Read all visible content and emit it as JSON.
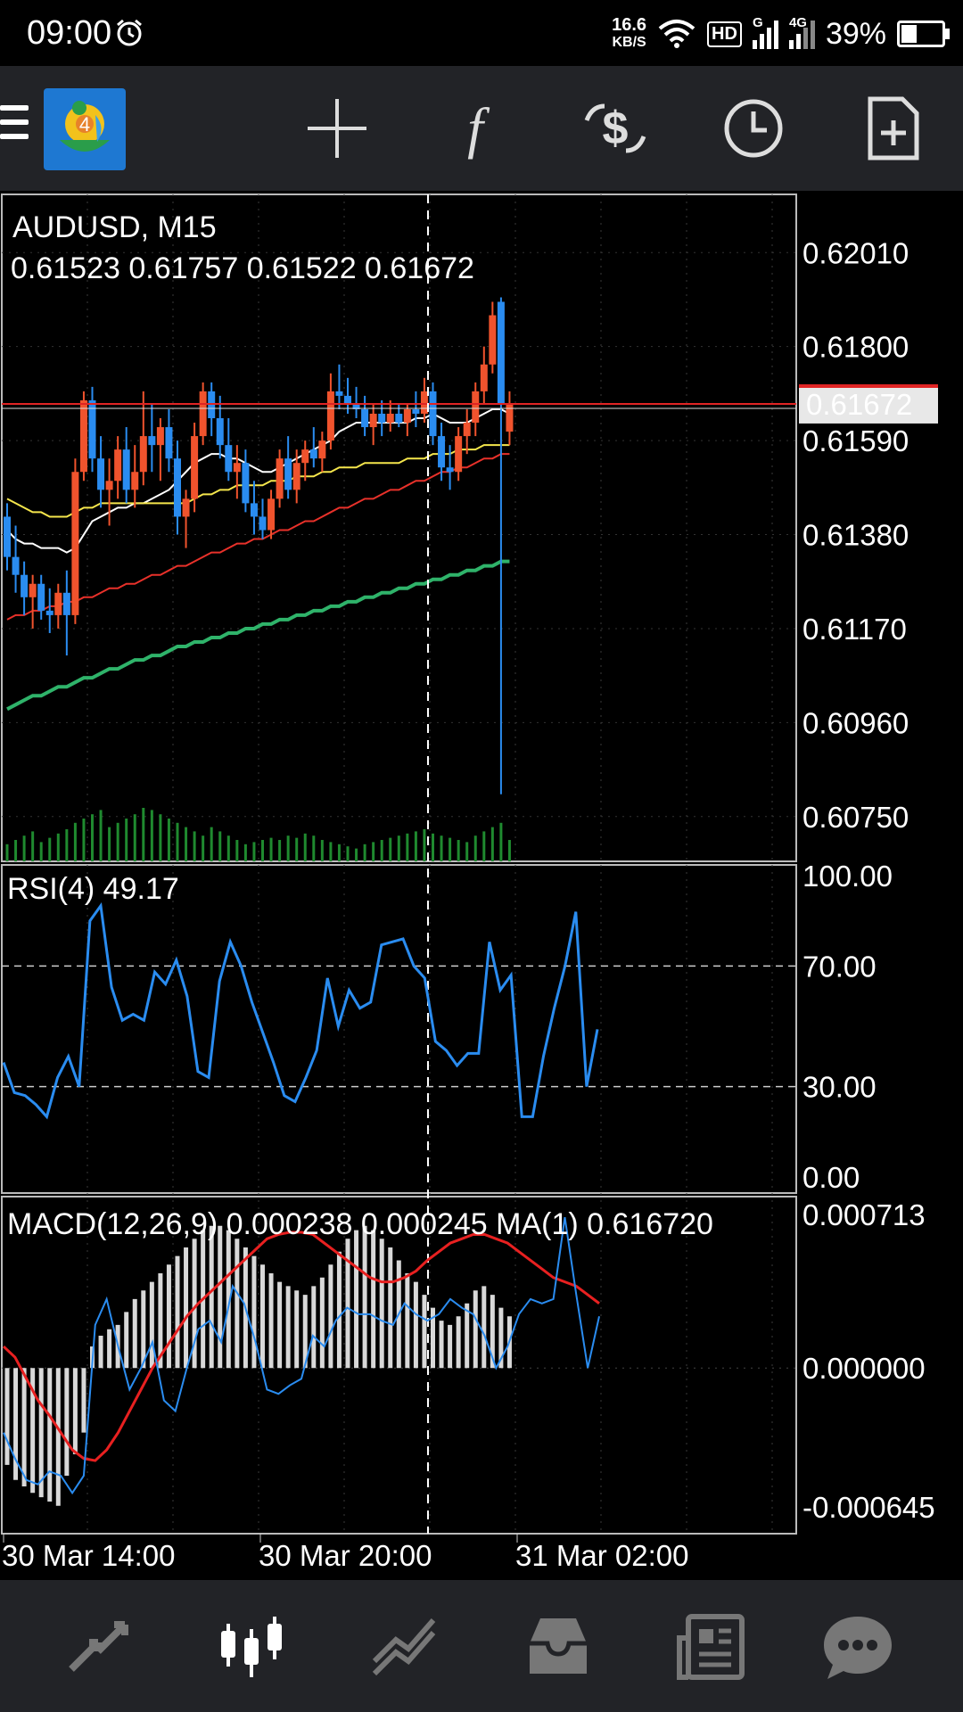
{
  "status_bar": {
    "time": "09:00",
    "speed_value": "16.6",
    "speed_unit": "KB/S",
    "hd": "HD",
    "network_1": "G",
    "network_2": "4G",
    "battery": "39%",
    "battery_level": 0.39
  },
  "toolbar": {
    "logo_badge": "4",
    "icons": [
      "menu-icon",
      "mt4-logo-icon",
      "crosshair-icon",
      "indicators-icon",
      "trade-icon",
      "timeframe-icon",
      "new-order-icon"
    ]
  },
  "chart_data": [
    {
      "type": "candlestick",
      "symbol_label": "AUDUSD, M15",
      "ohlc_label": "0.61523 0.61757 0.61522 0.61672",
      "current_price": "0.61672",
      "ylim": [
        0.6065,
        0.6214
      ],
      "y_ticks": [
        "0.62010",
        "0.61800",
        "0.61590",
        "0.61380",
        "0.61170",
        "0.60960",
        "0.60750"
      ],
      "candles": [
        [
          0.6142,
          0.6145,
          0.613,
          0.6133
        ],
        [
          0.6133,
          0.614,
          0.6125,
          0.6129
        ],
        [
          0.6129,
          0.6132,
          0.612,
          0.6124
        ],
        [
          0.6124,
          0.6129,
          0.6117,
          0.6127
        ],
        [
          0.6127,
          0.6129,
          0.6119,
          0.6121
        ],
        [
          0.6121,
          0.6126,
          0.6116,
          0.612
        ],
        [
          0.612,
          0.6127,
          0.6117,
          0.6125
        ],
        [
          0.6125,
          0.613,
          0.6111,
          0.612
        ],
        [
          0.612,
          0.6155,
          0.6118,
          0.6152
        ],
        [
          0.6152,
          0.617,
          0.615,
          0.6168
        ],
        [
          0.6168,
          0.6171,
          0.6152,
          0.6155
        ],
        [
          0.6155,
          0.616,
          0.6144,
          0.6148
        ],
        [
          0.6148,
          0.6155,
          0.614,
          0.615
        ],
        [
          0.615,
          0.616,
          0.6146,
          0.6157
        ],
        [
          0.6157,
          0.6162,
          0.6145,
          0.6148
        ],
        [
          0.6148,
          0.6158,
          0.6144,
          0.6152
        ],
        [
          0.6152,
          0.617,
          0.6149,
          0.616
        ],
        [
          0.616,
          0.6167,
          0.6152,
          0.6158
        ],
        [
          0.6158,
          0.6164,
          0.615,
          0.6162
        ],
        [
          0.6162,
          0.6166,
          0.6152,
          0.6155
        ],
        [
          0.6155,
          0.6159,
          0.6138,
          0.6142
        ],
        [
          0.6142,
          0.6148,
          0.6135,
          0.6146
        ],
        [
          0.6146,
          0.6163,
          0.6143,
          0.616
        ],
        [
          0.616,
          0.6172,
          0.6158,
          0.617
        ],
        [
          0.617,
          0.6172,
          0.616,
          0.6164
        ],
        [
          0.6164,
          0.6169,
          0.6155,
          0.6158
        ],
        [
          0.6158,
          0.6164,
          0.615,
          0.6152
        ],
        [
          0.6152,
          0.6158,
          0.6146,
          0.6154
        ],
        [
          0.6154,
          0.6157,
          0.6143,
          0.6145
        ],
        [
          0.6145,
          0.615,
          0.6138,
          0.6142
        ],
        [
          0.6142,
          0.6146,
          0.6137,
          0.6139
        ],
        [
          0.6139,
          0.6148,
          0.6137,
          0.6146
        ],
        [
          0.6146,
          0.6157,
          0.6144,
          0.6155
        ],
        [
          0.6155,
          0.616,
          0.6146,
          0.6148
        ],
        [
          0.6148,
          0.6157,
          0.6145,
          0.6154
        ],
        [
          0.6154,
          0.6159,
          0.615,
          0.6157
        ],
        [
          0.6157,
          0.6162,
          0.6153,
          0.6155
        ],
        [
          0.6155,
          0.6161,
          0.6152,
          0.6159
        ],
        [
          0.6159,
          0.6174,
          0.6157,
          0.617
        ],
        [
          0.617,
          0.6176,
          0.6166,
          0.6169
        ],
        [
          0.6169,
          0.6173,
          0.6165,
          0.6167
        ],
        [
          0.6167,
          0.6171,
          0.6164,
          0.6166
        ],
        [
          0.6166,
          0.6169,
          0.616,
          0.6162
        ],
        [
          0.6162,
          0.6167,
          0.6158,
          0.6165
        ],
        [
          0.6165,
          0.6168,
          0.616,
          0.6163
        ],
        [
          0.6163,
          0.6168,
          0.6161,
          0.6165
        ],
        [
          0.6165,
          0.6167,
          0.6162,
          0.6163
        ],
        [
          0.6163,
          0.6167,
          0.616,
          0.6166
        ],
        [
          0.6166,
          0.617,
          0.6162,
          0.6165
        ],
        [
          0.6165,
          0.6173,
          0.6163,
          0.617
        ],
        [
          0.617,
          0.6172,
          0.6158,
          0.616
        ],
        [
          0.616,
          0.6163,
          0.615,
          0.6153
        ],
        [
          0.6153,
          0.6158,
          0.6148,
          0.6152
        ],
        [
          0.6152,
          0.6162,
          0.615,
          0.616
        ],
        [
          0.616,
          0.6166,
          0.6156,
          0.6163
        ],
        [
          0.6163,
          0.6172,
          0.616,
          0.617
        ],
        [
          0.617,
          0.618,
          0.6167,
          0.6176
        ],
        [
          0.6176,
          0.619,
          0.6174,
          0.6187
        ],
        [
          0.619,
          0.6191,
          0.608,
          0.6167
        ],
        [
          0.6161,
          0.617,
          0.6158,
          0.6167
        ]
      ],
      "moving_averages": [
        {
          "color": "#ffffff",
          "values": [
            0.6139,
            0.6137,
            0.6136,
            0.6136,
            0.6135,
            0.6135,
            0.6135,
            0.6134,
            0.6135,
            0.6138,
            0.6141,
            0.6142,
            0.6143,
            0.6144,
            0.6144,
            0.6145,
            0.6145,
            0.6146,
            0.6147,
            0.6148,
            0.615,
            0.6152,
            0.6154,
            0.6155,
            0.6156,
            0.6156,
            0.6155,
            0.6155,
            0.6154,
            0.6153,
            0.6152,
            0.6152,
            0.6153,
            0.6154,
            0.6155,
            0.6156,
            0.6157,
            0.6158,
            0.6159,
            0.6161,
            0.6162,
            0.6163,
            0.6163,
            0.6163,
            0.6163,
            0.6163,
            0.6163,
            0.6163,
            0.6164,
            0.6164,
            0.6165,
            0.6164,
            0.6163,
            0.6163,
            0.6163,
            0.6164,
            0.6165,
            0.6166,
            0.6166,
            0.6165
          ]
        },
        {
          "color": "#f5e64c",
          "values": [
            0.6146,
            0.6145,
            0.6144,
            0.6143,
            0.6143,
            0.6142,
            0.6142,
            0.6142,
            0.6143,
            0.6144,
            0.6144,
            0.6145,
            0.6145,
            0.6145,
            0.6145,
            0.6145,
            0.6145,
            0.6145,
            0.6145,
            0.6145,
            0.6145,
            0.6145,
            0.6146,
            0.6147,
            0.6147,
            0.6148,
            0.6148,
            0.6149,
            0.6149,
            0.6149,
            0.6149,
            0.615,
            0.615,
            0.615,
            0.6151,
            0.6151,
            0.6151,
            0.6152,
            0.6152,
            0.6153,
            0.6153,
            0.6153,
            0.6154,
            0.6154,
            0.6154,
            0.6154,
            0.6154,
            0.6155,
            0.6155,
            0.6155,
            0.6156,
            0.6156,
            0.6156,
            0.6157,
            0.6157,
            0.6157,
            0.6158,
            0.6158,
            0.6158,
            0.6158
          ]
        },
        {
          "color": "#e8312a",
          "values": [
            0.6119,
            0.612,
            0.612,
            0.6121,
            0.6121,
            0.6122,
            0.6122,
            0.6123,
            0.6123,
            0.6124,
            0.6124,
            0.6125,
            0.6126,
            0.6126,
            0.6127,
            0.6127,
            0.6128,
            0.6129,
            0.6129,
            0.613,
            0.6131,
            0.6131,
            0.6132,
            0.6133,
            0.6134,
            0.6134,
            0.6135,
            0.6136,
            0.6136,
            0.6137,
            0.6137,
            0.6138,
            0.6139,
            0.6139,
            0.614,
            0.6141,
            0.6141,
            0.6142,
            0.6143,
            0.6144,
            0.6144,
            0.6145,
            0.6146,
            0.6146,
            0.6147,
            0.6148,
            0.6148,
            0.6149,
            0.615,
            0.615,
            0.6151,
            0.6152,
            0.6152,
            0.6153,
            0.6153,
            0.6154,
            0.6155,
            0.6155,
            0.6156,
            0.6156
          ]
        },
        {
          "color": "#2fb36a",
          "values": [
            0.6099,
            0.61,
            0.6101,
            0.6102,
            0.6102,
            0.6103,
            0.6104,
            0.6104,
            0.6105,
            0.6106,
            0.6106,
            0.6107,
            0.6108,
            0.6108,
            0.6109,
            0.611,
            0.611,
            0.6111,
            0.6111,
            0.6112,
            0.6113,
            0.6113,
            0.6114,
            0.6114,
            0.6115,
            0.6115,
            0.6116,
            0.6116,
            0.6117,
            0.6117,
            0.6118,
            0.6118,
            0.6119,
            0.6119,
            0.612,
            0.612,
            0.6121,
            0.6121,
            0.6122,
            0.6122,
            0.6123,
            0.6123,
            0.6124,
            0.6124,
            0.6125,
            0.6125,
            0.6126,
            0.6126,
            0.6127,
            0.6127,
            0.6128,
            0.6128,
            0.6129,
            0.6129,
            0.613,
            0.613,
            0.6131,
            0.6131,
            0.6132,
            0.6132
          ]
        }
      ],
      "volume": [
        8,
        10,
        12,
        14,
        9,
        11,
        13,
        15,
        18,
        20,
        22,
        24,
        16,
        18,
        20,
        22,
        25,
        24,
        22,
        20,
        18,
        16,
        14,
        12,
        16,
        14,
        12,
        10,
        8,
        9,
        10,
        11,
        10,
        12,
        11,
        13,
        12,
        10,
        9,
        8,
        7,
        6,
        8,
        9,
        10,
        11,
        12,
        13,
        14,
        15,
        13,
        12,
        11,
        10,
        9,
        12,
        14,
        16,
        18,
        10
      ]
    },
    {
      "type": "line",
      "label": "RSI(4) 49.17",
      "ylim": [
        0,
        100
      ],
      "y_ticks": [
        "100.00",
        "70.00",
        "30.00",
        "0.00"
      ],
      "levels": [
        70,
        30
      ],
      "values": [
        38,
        28,
        27,
        24,
        20,
        33,
        40,
        30,
        85,
        90,
        63,
        52,
        54,
        52,
        68,
        64,
        72,
        60,
        35,
        33,
        65,
        78,
        70,
        58,
        48,
        38,
        27,
        25,
        33,
        42,
        66,
        50,
        62,
        56,
        58,
        77,
        78,
        79,
        70,
        66,
        45,
        42,
        37,
        41,
        41,
        78,
        62,
        67,
        20,
        20,
        40,
        56,
        70,
        88,
        30,
        49
      ]
    },
    {
      "type": "line+histogram",
      "label": "MACD(12,26,9) 0.000238 0.000245 MA(1) 0.616720",
      "ylim": [
        -0.000645,
        0.000713
      ],
      "y_ticks": [
        "0.000713",
        "0.000000",
        "-0.000645"
      ],
      "histogram": [
        -0.00045,
        -0.00052,
        -0.00055,
        -0.00058,
        -0.0006,
        -0.00062,
        -0.00064,
        -0.0005,
        -0.0004,
        -0.0003,
        0.0001,
        0.00015,
        0.00018,
        0.0002,
        0.00026,
        0.00032,
        0.00036,
        0.0004,
        0.00044,
        0.00048,
        0.00052,
        0.00056,
        0.0006,
        0.00064,
        0.00066,
        0.00066,
        0.00064,
        0.0006,
        0.00056,
        0.00052,
        0.00048,
        0.00044,
        0.0004,
        0.00038,
        0.00036,
        0.00034,
        0.00038,
        0.00042,
        0.00048,
        0.00054,
        0.0006,
        0.00064,
        0.00066,
        0.00064,
        0.0006,
        0.00056,
        0.0005,
        0.00044,
        0.0004,
        0.00034,
        0.00028,
        0.00022,
        0.0002,
        0.00024,
        0.0003,
        0.00036,
        0.00038,
        0.00034,
        0.00028,
        0.00024
      ],
      "signal": [
        0.0001,
        5e-05,
        -5e-05,
        -0.00015,
        -0.00022,
        -0.0003,
        -0.00038,
        -0.00042,
        -0.00043,
        -0.00038,
        -0.0003,
        -0.0002,
        -0.0001,
        0.0,
        8e-05,
        0.00016,
        0.00024,
        0.0003,
        0.00035,
        0.0004,
        0.00045,
        0.0005,
        0.00055,
        0.0006,
        0.00062,
        0.00063,
        0.00063,
        0.00062,
        0.00058,
        0.00054,
        0.0005,
        0.00046,
        0.00042,
        0.0004,
        0.0004,
        0.00042,
        0.00045,
        0.0005,
        0.00054,
        0.00058,
        0.0006,
        0.00062,
        0.00062,
        0.0006,
        0.00058,
        0.00054,
        0.0005,
        0.00046,
        0.00042,
        0.0004,
        0.00038,
        0.00034,
        0.0003
      ],
      "macd": [
        -0.0003,
        -0.00042,
        -0.00052,
        -0.00054,
        -0.00048,
        -0.0005,
        -0.00058,
        -0.0005,
        0.0002,
        0.00032,
        0.0001,
        -0.0001,
        0.0,
        0.00012,
        -0.00015,
        -0.0002,
        0.0,
        0.00018,
        0.00022,
        0.00012,
        0.00038,
        0.0003,
        0.00012,
        -0.0001,
        -0.00012,
        -8e-05,
        -5e-05,
        0.00015,
        0.0001,
        0.00022,
        0.00028,
        0.00025,
        0.00025,
        0.00022,
        0.0002,
        0.0003,
        0.00025,
        0.00022,
        0.00025,
        0.00032,
        0.00028,
        0.00025,
        0.00015,
        0.0,
        0.0001,
        0.00025,
        0.00032,
        0.0003,
        0.00032,
        0.0007,
        0.00034,
        0.0,
        0.00024
      ]
    }
  ],
  "x_axis": {
    "labels": [
      "30 Mar 14:00",
      "30 Mar 20:00",
      "31 Mar 02:00"
    ]
  },
  "bottom_nav": {
    "items": [
      "quotes-icon",
      "chart-icon",
      "trade-icon",
      "history-icon",
      "news-icon",
      "chat-icon"
    ]
  }
}
